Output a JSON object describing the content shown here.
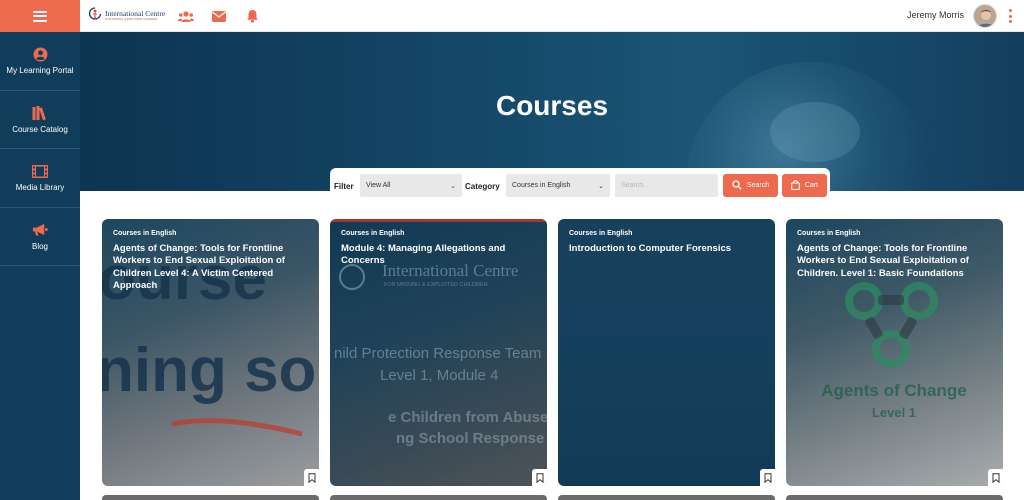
{
  "header": {
    "menu_icon": "hamburger-icon",
    "logo": {
      "name": "International Centre",
      "tagline": "FOR MISSING & EXPLOITED CHILDREN"
    },
    "icons": [
      "users-icon",
      "envelope-icon",
      "bell-icon"
    ],
    "user_name": "Jeremy Morris",
    "more_icon": "kebab-menu-icon",
    "accent_color": "#ee6a4f"
  },
  "sidebar": {
    "items": [
      {
        "label": "My Learning Portal",
        "icon": "user-circle-icon"
      },
      {
        "label": "Course Catalog",
        "icon": "books-icon"
      },
      {
        "label": "Media Library",
        "icon": "film-icon"
      },
      {
        "label": "Blog",
        "icon": "megaphone-icon"
      }
    ]
  },
  "hero": {
    "title": "Courses"
  },
  "filters": {
    "filter_label": "Filter",
    "filter_value": "View All",
    "category_label": "Category",
    "category_value": "Courses in English",
    "search_placeholder": "Search...",
    "search_button": "Search",
    "cart_button": "Cart"
  },
  "courses": [
    {
      "category": "Courses in English",
      "title": "Agents of Change: Tools for Frontline Workers to End Sexual Exploitation of Children Level 4: A Victim Centered Approach",
      "art_text": [
        "ourse",
        "ning so"
      ]
    },
    {
      "category": "Courses in English",
      "title": "Module 4: Managing Allegations and Concerns",
      "art_logo": "International Centre",
      "art_logo_sub": "FOR MISSING & EXPLOITED CHILDREN",
      "art_text": [
        "nild Protection Response Team",
        "Level 1, Module 4",
        "e Children from Abuse b",
        "ng School Response"
      ]
    },
    {
      "category": "Courses in English",
      "title": "Introduction to Computer Forensics"
    },
    {
      "category": "Courses in English",
      "title": "Agents of Change: Tools for Frontline Workers to End Sexual Exploitation of Children. Level 1: Basic Foundations",
      "art_text": [
        "Agents of Change",
        "Level 1"
      ]
    }
  ]
}
